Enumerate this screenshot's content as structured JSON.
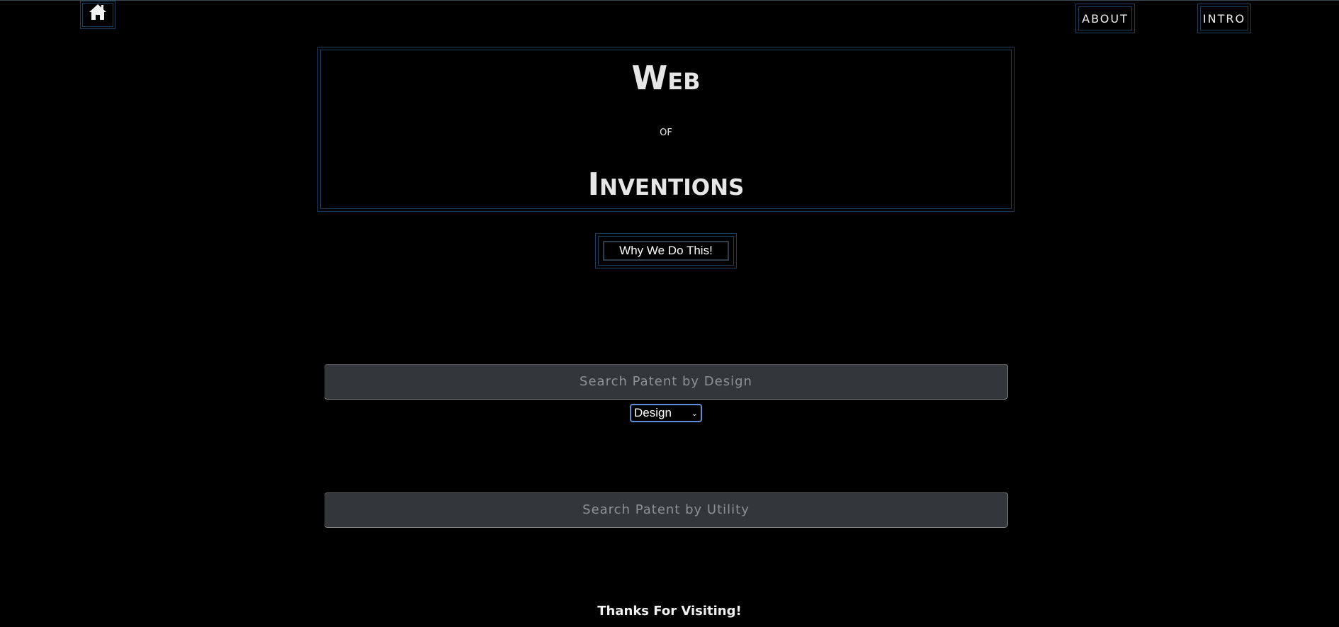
{
  "nav": {
    "home_icon": "home-icon",
    "about_label": "ABOUT",
    "intro_label": "INTRO"
  },
  "title": {
    "line1": "Web",
    "line2": "of",
    "line3": "Inventions"
  },
  "why_button": {
    "label": "Why We Do This!"
  },
  "search": {
    "design_placeholder": "Search Patent by Design",
    "utility_placeholder": "Search Patent by Utility",
    "type_select_value": "Design"
  },
  "footer": {
    "text": "Thanks For Visiting!"
  },
  "colors": {
    "background": "#000000",
    "frame_border": "#1d3d5a",
    "input_bg": "#33373b",
    "select_focus": "#5c8dd6"
  }
}
